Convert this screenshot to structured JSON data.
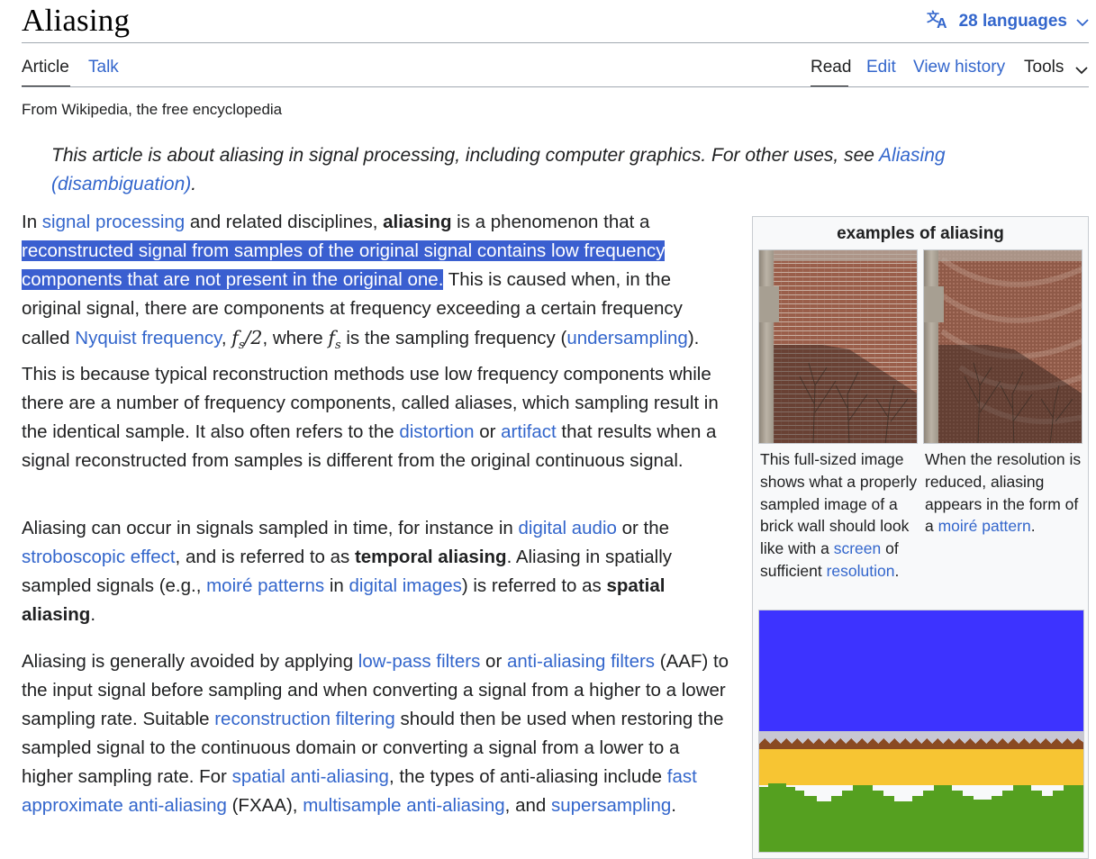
{
  "page": {
    "title": "Aliasing",
    "languages_label": "28 languages"
  },
  "tabs": {
    "article": "Article",
    "talk": "Talk",
    "read": "Read",
    "edit": "Edit",
    "view_history": "View history",
    "tools": "Tools"
  },
  "tagline": "From Wikipedia, the free encyclopedia",
  "hatnote": {
    "text": "This article is about aliasing in signal processing, including computer graphics. For other uses, see ",
    "link": "Aliasing (disambiguation)",
    "end": "."
  },
  "p1": {
    "s1": "In ",
    "l1": "signal processing",
    "s2": " and related disciplines, ",
    "b1": "aliasing",
    "s3": " is a phenomenon that a ",
    "highlighted": "reconstructed signal from samples of the original signal contains low frequency components that are not present in the original one.",
    "s4": " This is caused when, in the original signal, there are components at frequency exceeding a certain frequency called ",
    "l2": "Nyquist frequency",
    "s5": ", ",
    "math1": "f",
    "math1_sub": "s",
    "math1_rest": "/2",
    "s6": ", where ",
    "math2": "f",
    "math2_sub": "s",
    "s7": " is the sampling frequency (",
    "l3": "undersampling",
    "s8": "). This is because typical reconstruction methods use low frequency components while there are a number of frequency components, called aliases, which sampling result in the identical sample. It also often refers to the ",
    "l4": "distortion",
    "s9": " or ",
    "l5": "artifact",
    "s10": " that results when a signal reconstructed from samples is different from the original continuous signal."
  },
  "p2": {
    "s1": "Aliasing can occur in signals sampled in time, for instance in ",
    "l1": "digital audio",
    "s2": " or the ",
    "l2": "stroboscopic effect",
    "s3": ", and is referred to as ",
    "b1": "temporal aliasing",
    "s4": ". Aliasing in spatially sampled signals (e.g., ",
    "l3": "moiré patterns",
    "s5": " in ",
    "l4": "digital images",
    "s6": ") is referred to as ",
    "b2": "spatial aliasing",
    "s7": "."
  },
  "p3": {
    "s1": "Aliasing is generally avoided by applying ",
    "l1": "low-pass filters",
    "s2": " or ",
    "l2": "anti-aliasing filters",
    "s3": " (AAF) to the input signal before sampling and when converting a signal from a higher to a lower sampling rate. Suitable ",
    "l3": "reconstruction filtering",
    "s4": " should then be used when restoring the sampled signal to the continuous domain or converting a signal from a lower to a higher sampling rate. For ",
    "l4": "spatial anti-aliasing",
    "s5": ", the types of anti-aliasing include ",
    "l5": "fast approximate anti-aliasing",
    "s6": " (FXAA), ",
    "l6": "multisample anti-aliasing",
    "s7": ", and ",
    "l7": "supersampling",
    "s8": "."
  },
  "infobox": {
    "title": "examples of aliasing",
    "caption_left": {
      "s1": "This full-sized image shows what a properly sampled image of a brick wall should look like with a ",
      "l1": "screen",
      "s2": " of sufficient ",
      "l2": "resolution",
      "s3": "."
    },
    "caption_right": {
      "s1": "When the resolution is reduced, aliasing appears in the form of a ",
      "l1": "moiré pattern",
      "s2": "."
    }
  },
  "colors": {
    "link": "#3366cc",
    "highlight": "#3a5fd0",
    "game_sky": "#3d33ff",
    "game_sand": "#f7c533",
    "game_grass": "#55a020"
  },
  "icons": {
    "language": "translate-icon",
    "dropdown": "chevron-down-icon"
  }
}
